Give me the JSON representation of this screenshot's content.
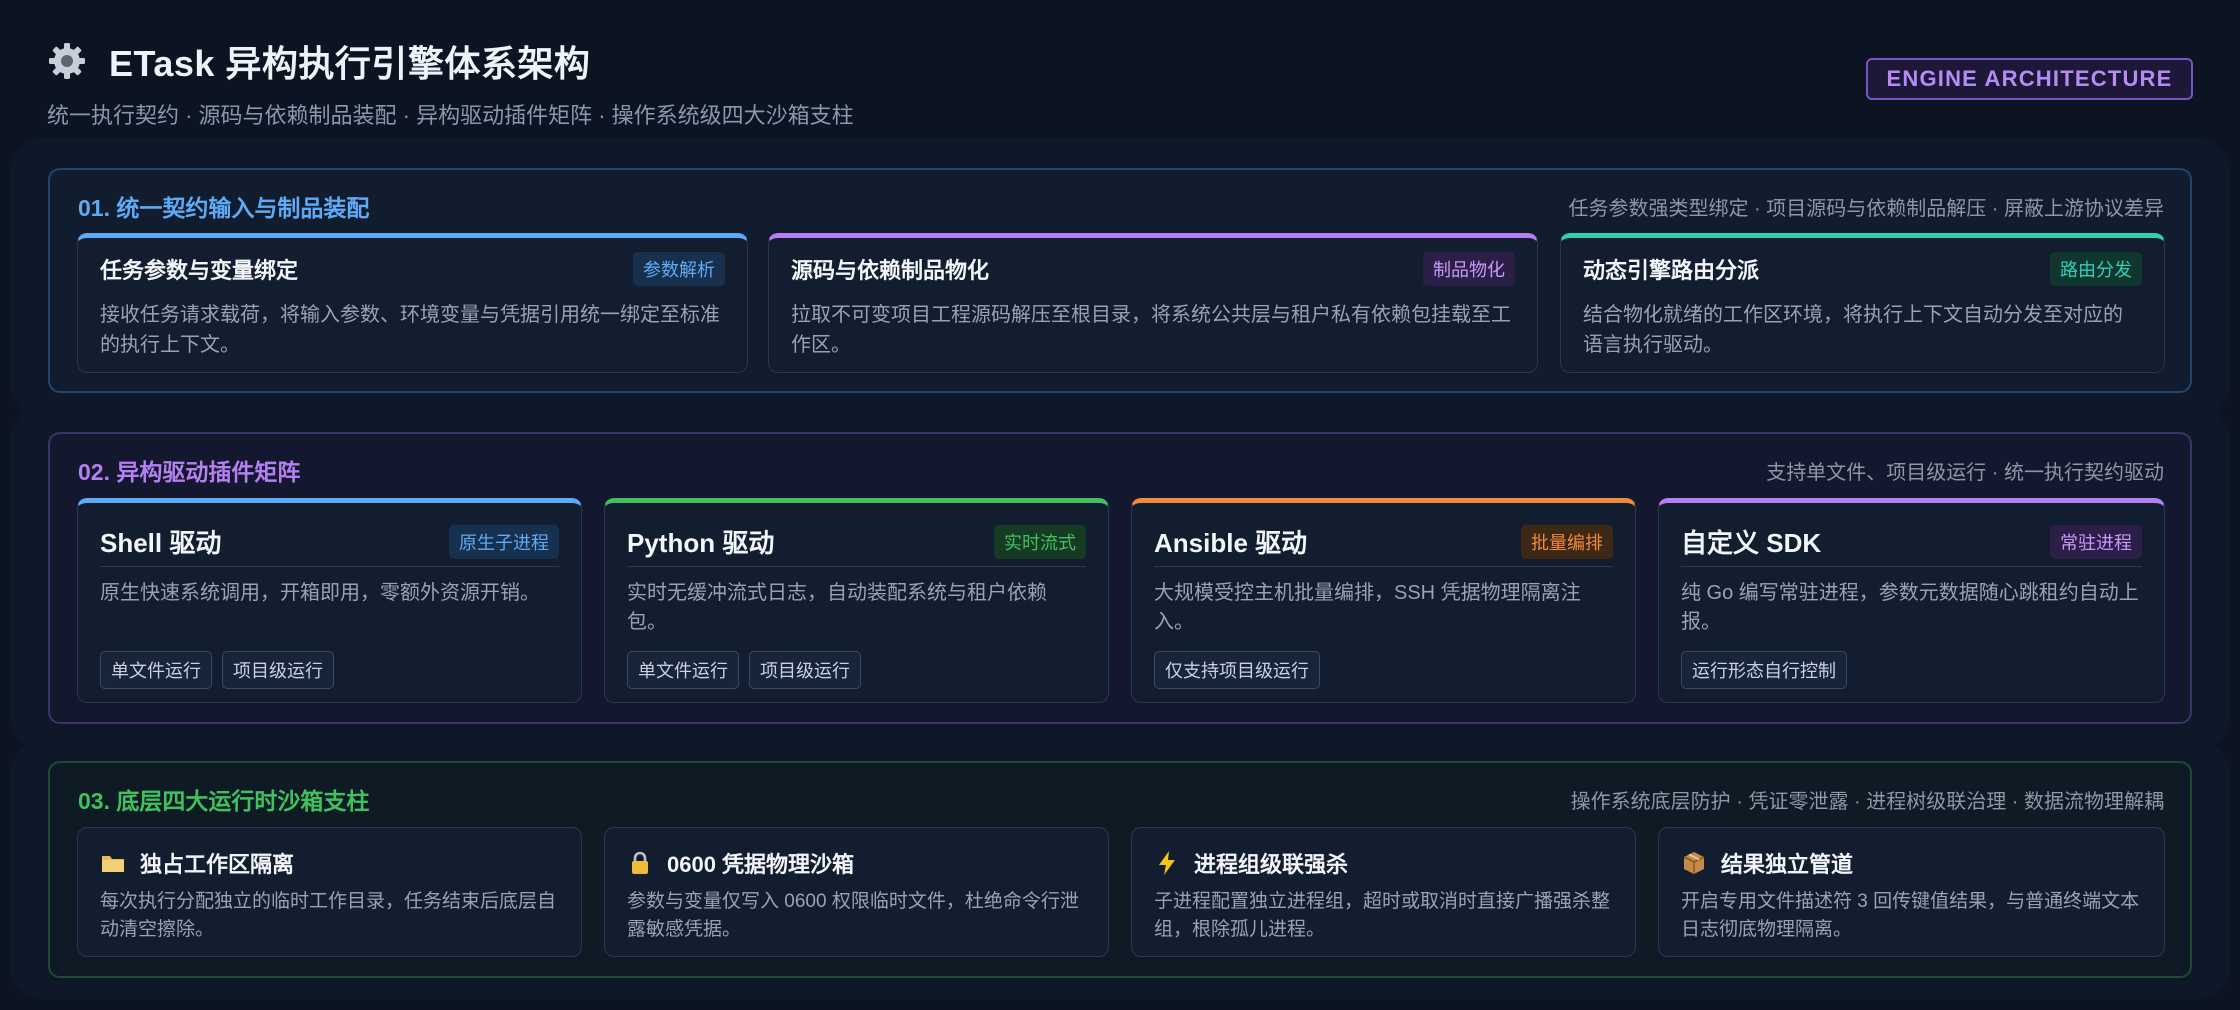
{
  "header": {
    "title": "ETask 异构执行引擎体系架构",
    "subtitle": "统一执行契约 · 源码与依赖制品装配 · 异构驱动插件矩阵 · 操作系统级四大沙箱支柱",
    "badge": "ENGINE ARCHITECTURE",
    "icon": "gear-icon"
  },
  "colors": {
    "blue": "#5eaaf5",
    "purple": "#b47ff0",
    "teal": "#2fd1b4",
    "green": "#3fc15d",
    "orange": "#f0893a"
  },
  "section1": {
    "title": "01. 统一契约输入与制品装配",
    "note": "任务参数强类型绑定 · 项目源码与依赖制品解压 · 屏蔽上游协议差异",
    "cards": [
      {
        "title": "任务参数与变量绑定",
        "tag": "参数解析",
        "desc": "接收任务请求载荷，将输入参数、环境变量与凭据引用统一绑定至标准的执行上下文。"
      },
      {
        "title": "源码与依赖制品物化",
        "tag": "制品物化",
        "desc": "拉取不可变项目工程源码解压至根目录，将系统公共层与租户私有依赖包挂载至工作区。"
      },
      {
        "title": "动态引擎路由分派",
        "tag": "路由分发",
        "desc": "结合物化就绪的工作区环境，将执行上下文自动分发至对应的语言执行驱动。"
      }
    ]
  },
  "section2": {
    "title": "02. 异构驱动插件矩阵",
    "note": "支持单文件、项目级运行 · 统一执行契约驱动",
    "cards": [
      {
        "title": "Shell 驱动",
        "tag": "原生子进程",
        "desc": "原生快速系统调用，开箱即用，零额外资源开销。",
        "chips": [
          "单文件运行",
          "项目级运行"
        ]
      },
      {
        "title": "Python 驱动",
        "tag": "实时流式",
        "desc": "实时无缓冲流式日志，自动装配系统与租户依赖包。",
        "chips": [
          "单文件运行",
          "项目级运行"
        ]
      },
      {
        "title": "Ansible 驱动",
        "tag": "批量编排",
        "desc": "大规模受控主机批量编排，SSH 凭据物理隔离注入。",
        "chips": [
          "仅支持项目级运行"
        ]
      },
      {
        "title": "自定义 SDK",
        "tag": "常驻进程",
        "desc": "纯 Go 编写常驻进程，参数元数据随心跳租约自动上报。",
        "chips": [
          "运行形态自行控制"
        ]
      }
    ]
  },
  "section3": {
    "title": "03. 底层四大运行时沙箱支柱",
    "note": "操作系统底层防护 · 凭证零泄露 · 进程树级联治理 · 数据流物理解耦",
    "cards": [
      {
        "icon": "folder-icon",
        "title": "独占工作区隔离",
        "desc": "每次执行分配独立的临时工作目录，任务结束后底层自动清空擦除。"
      },
      {
        "icon": "lock-icon",
        "title": "0600 凭据物理沙箱",
        "desc": "参数与变量仅写入 0600 权限临时文件，杜绝命令行泄露敏感凭据。"
      },
      {
        "icon": "lightning-icon",
        "title": "进程组级联强杀",
        "desc": "子进程配置独立进程组，超时或取消时直接广播强杀整组，根除孤儿进程。"
      },
      {
        "icon": "package-icon",
        "title": "结果独立管道",
        "desc": "开启专用文件描述符 3 回传键值结果，与普通终端文本日志彻底物理隔离。"
      }
    ]
  }
}
